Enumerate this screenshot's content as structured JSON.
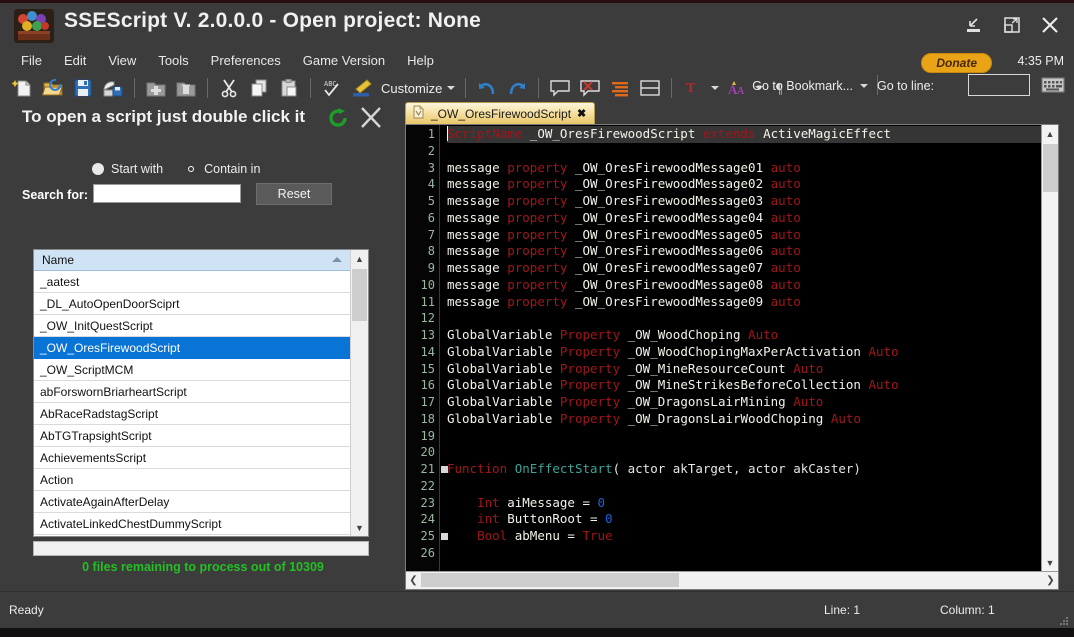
{
  "window": {
    "title": "SSEScript V. 2.0.0.0 - Open project: None",
    "icon": "app-logo-icon",
    "minimize": "minimize-icon",
    "maximize": "restore-icon",
    "close": "close-icon"
  },
  "menubar": {
    "items": [
      {
        "label": "File"
      },
      {
        "label": "Edit"
      },
      {
        "label": "View"
      },
      {
        "label": "Tools"
      },
      {
        "label": "Preferences"
      },
      {
        "label": "Game Version"
      },
      {
        "label": "Help"
      }
    ]
  },
  "toolbar": {
    "customize_label": "Customize",
    "buttons": [
      {
        "name": "new-file-icon"
      },
      {
        "name": "open-folder-icon"
      },
      {
        "name": "save-icon"
      },
      {
        "name": "save-as-icon"
      },
      {
        "name": "delete-folder-icon"
      },
      {
        "name": "remove-folder-icon"
      },
      {
        "name": "cut-icon"
      },
      {
        "name": "copy-icon"
      },
      {
        "name": "paste-icon"
      },
      {
        "name": "spellcheck-icon"
      },
      {
        "name": "format-brush-icon"
      },
      {
        "name": "undo-icon"
      },
      {
        "name": "redo-icon"
      },
      {
        "name": "comment-icon"
      },
      {
        "name": "delete-comment-icon"
      },
      {
        "name": "indent-lines-icon"
      },
      {
        "name": "split-view-icon"
      },
      {
        "name": "text-color-icon"
      },
      {
        "name": "font-size-icon"
      },
      {
        "name": "pilcrow-icon"
      }
    ]
  },
  "topright": {
    "donate_label": "Donate",
    "clock": "4:35 PM",
    "go_to_bookmark_label": "Go to Bookmark...",
    "go_to_line_label": "Go to line:",
    "go_to_line_value": "",
    "keyboard_icon": "keyboard-icon"
  },
  "leftpane": {
    "hint": "To open a script just double click it",
    "refresh_icon": "refresh-icon",
    "close_icon": "close-icon",
    "radio_start_with": "Start with",
    "radio_contain_in": "Contain in",
    "selected_radio": "Contain in",
    "search_label": "Search for:",
    "search_value": "",
    "search_placeholder": "",
    "reset_label": "Reset",
    "list_header": "Name",
    "list_items": [
      {
        "label": "_aatest",
        "selected": false
      },
      {
        "label": "_DL_AutoOpenDoorSciprt",
        "selected": false
      },
      {
        "label": "_OW_InitQuestScript",
        "selected": false
      },
      {
        "label": "_OW_OresFirewoodScript",
        "selected": true
      },
      {
        "label": "_OW_ScriptMCM",
        "selected": false
      },
      {
        "label": "abForswornBriarheartScript",
        "selected": false
      },
      {
        "label": "AbRaceRadstagScript",
        "selected": false
      },
      {
        "label": "AbTGTrapsightScript",
        "selected": false
      },
      {
        "label": "AchievementsScript",
        "selected": false
      },
      {
        "label": "Action",
        "selected": false
      },
      {
        "label": "ActivateAgainAfterDelay",
        "selected": false
      },
      {
        "label": "ActivateLinkedChestDummyScript",
        "selected": false
      }
    ],
    "remaining_text": "0 files remaining to process out of 10309"
  },
  "editor": {
    "tab_label": "_OW_OresFirewoodScript",
    "tab_icon": "script-file-icon",
    "tab_close": "close-icon",
    "lines": [
      {
        "n": 1,
        "current": true,
        "fold": false,
        "tokens": [
          {
            "t": "ScriptName",
            "c": "k"
          },
          {
            "t": " _OW_OresFirewoodScript ",
            "c": "id"
          },
          {
            "t": "extends",
            "c": "k"
          },
          {
            "t": " ActiveMagicEffect",
            "c": "id"
          }
        ]
      },
      {
        "n": 2,
        "current": false,
        "fold": false,
        "tokens": []
      },
      {
        "n": 3,
        "current": false,
        "fold": false,
        "tokens": [
          {
            "t": "message ",
            "c": "id"
          },
          {
            "t": "property",
            "c": "k"
          },
          {
            "t": " _OW_OresFirewoodMessage01 ",
            "c": "id"
          },
          {
            "t": "auto",
            "c": "k"
          }
        ]
      },
      {
        "n": 4,
        "current": false,
        "fold": false,
        "tokens": [
          {
            "t": "message ",
            "c": "id"
          },
          {
            "t": "property",
            "c": "k"
          },
          {
            "t": " _OW_OresFirewoodMessage02 ",
            "c": "id"
          },
          {
            "t": "auto",
            "c": "k"
          }
        ]
      },
      {
        "n": 5,
        "current": false,
        "fold": false,
        "tokens": [
          {
            "t": "message ",
            "c": "id"
          },
          {
            "t": "property",
            "c": "k"
          },
          {
            "t": " _OW_OresFirewoodMessage03 ",
            "c": "id"
          },
          {
            "t": "auto",
            "c": "k"
          }
        ]
      },
      {
        "n": 6,
        "current": false,
        "fold": false,
        "tokens": [
          {
            "t": "message ",
            "c": "id"
          },
          {
            "t": "property",
            "c": "k"
          },
          {
            "t": " _OW_OresFirewoodMessage04 ",
            "c": "id"
          },
          {
            "t": "auto",
            "c": "k"
          }
        ]
      },
      {
        "n": 7,
        "current": false,
        "fold": false,
        "tokens": [
          {
            "t": "message ",
            "c": "id"
          },
          {
            "t": "property",
            "c": "k"
          },
          {
            "t": " _OW_OresFirewoodMessage05 ",
            "c": "id"
          },
          {
            "t": "auto",
            "c": "k"
          }
        ]
      },
      {
        "n": 8,
        "current": false,
        "fold": false,
        "tokens": [
          {
            "t": "message ",
            "c": "id"
          },
          {
            "t": "property",
            "c": "k"
          },
          {
            "t": " _OW_OresFirewoodMessage06 ",
            "c": "id"
          },
          {
            "t": "auto",
            "c": "k"
          }
        ]
      },
      {
        "n": 9,
        "current": false,
        "fold": false,
        "tokens": [
          {
            "t": "message ",
            "c": "id"
          },
          {
            "t": "property",
            "c": "k"
          },
          {
            "t": " _OW_OresFirewoodMessage07 ",
            "c": "id"
          },
          {
            "t": "auto",
            "c": "k"
          }
        ]
      },
      {
        "n": 10,
        "current": false,
        "fold": false,
        "tokens": [
          {
            "t": "message ",
            "c": "id"
          },
          {
            "t": "property",
            "c": "k"
          },
          {
            "t": " _OW_OresFirewoodMessage08 ",
            "c": "id"
          },
          {
            "t": "auto",
            "c": "k"
          }
        ]
      },
      {
        "n": 11,
        "current": false,
        "fold": false,
        "tokens": [
          {
            "t": "message ",
            "c": "id"
          },
          {
            "t": "property",
            "c": "k"
          },
          {
            "t": " _OW_OresFirewoodMessage09 ",
            "c": "id"
          },
          {
            "t": "auto",
            "c": "k"
          }
        ]
      },
      {
        "n": 12,
        "current": false,
        "fold": false,
        "tokens": []
      },
      {
        "n": 13,
        "current": false,
        "fold": false,
        "tokens": [
          {
            "t": "GlobalVariable ",
            "c": "id"
          },
          {
            "t": "Property",
            "c": "k"
          },
          {
            "t": " _OW_WoodChoping ",
            "c": "id"
          },
          {
            "t": "Auto",
            "c": "k"
          }
        ]
      },
      {
        "n": 14,
        "current": false,
        "fold": false,
        "tokens": [
          {
            "t": "GlobalVariable ",
            "c": "id"
          },
          {
            "t": "Property",
            "c": "k"
          },
          {
            "t": " _OW_WoodChopingMaxPerActivation ",
            "c": "id"
          },
          {
            "t": "Auto",
            "c": "k"
          }
        ]
      },
      {
        "n": 15,
        "current": false,
        "fold": false,
        "tokens": [
          {
            "t": "GlobalVariable ",
            "c": "id"
          },
          {
            "t": "Property",
            "c": "k"
          },
          {
            "t": " _OW_MineResourceCount ",
            "c": "id"
          },
          {
            "t": "Auto",
            "c": "k"
          }
        ]
      },
      {
        "n": 16,
        "current": false,
        "fold": false,
        "tokens": [
          {
            "t": "GlobalVariable ",
            "c": "id"
          },
          {
            "t": "Property",
            "c": "k"
          },
          {
            "t": " _OW_MineStrikesBeforeCollection ",
            "c": "id"
          },
          {
            "t": "Auto",
            "c": "k"
          }
        ]
      },
      {
        "n": 17,
        "current": false,
        "fold": false,
        "tokens": [
          {
            "t": "GlobalVariable ",
            "c": "id"
          },
          {
            "t": "Property",
            "c": "k"
          },
          {
            "t": " _OW_DragonsLairMining ",
            "c": "id"
          },
          {
            "t": "Auto",
            "c": "k"
          }
        ]
      },
      {
        "n": 18,
        "current": false,
        "fold": false,
        "tokens": [
          {
            "t": "GlobalVariable ",
            "c": "id"
          },
          {
            "t": "Property",
            "c": "k"
          },
          {
            "t": " _OW_DragonsLairWoodChoping ",
            "c": "id"
          },
          {
            "t": "Auto",
            "c": "k"
          }
        ]
      },
      {
        "n": 19,
        "current": false,
        "fold": false,
        "tokens": []
      },
      {
        "n": 20,
        "current": false,
        "fold": false,
        "tokens": []
      },
      {
        "n": 21,
        "current": false,
        "fold": true,
        "tokens": [
          {
            "t": "Function ",
            "c": "k"
          },
          {
            "t": "OnEffectStart",
            "c": "fn"
          },
          {
            "t": "( actor akTarget, actor akCaster)",
            "c": "pn"
          }
        ]
      },
      {
        "n": 22,
        "current": false,
        "fold": false,
        "tokens": []
      },
      {
        "n": 23,
        "current": false,
        "fold": false,
        "tokens": [
          {
            "t": "    Int",
            "c": "k"
          },
          {
            "t": " aiMessage = ",
            "c": "id"
          },
          {
            "t": "0",
            "c": "num"
          }
        ]
      },
      {
        "n": 24,
        "current": false,
        "fold": false,
        "tokens": [
          {
            "t": "    int",
            "c": "k"
          },
          {
            "t": " ButtonRoot = ",
            "c": "id"
          },
          {
            "t": "0",
            "c": "num"
          }
        ]
      },
      {
        "n": 25,
        "current": false,
        "fold": true,
        "tokens": [
          {
            "t": "    Bool",
            "c": "k"
          },
          {
            "t": " abMenu = ",
            "c": "id"
          },
          {
            "t": "True",
            "c": "k"
          }
        ]
      },
      {
        "n": 26,
        "current": false,
        "fold": false,
        "tokens": []
      }
    ]
  },
  "statusbar": {
    "ready": "Ready",
    "line": "Line: 1",
    "column": "Column: 1"
  },
  "colors": {
    "chrome": "#3c3c3c",
    "accent_selected": "#0a74d6",
    "donate": "#e8a317",
    "success_text": "#22c022",
    "tab_gold": "#f4dd9a",
    "keyword": "#a0161b",
    "function": "#3ba39a",
    "number": "#1f63d8"
  }
}
